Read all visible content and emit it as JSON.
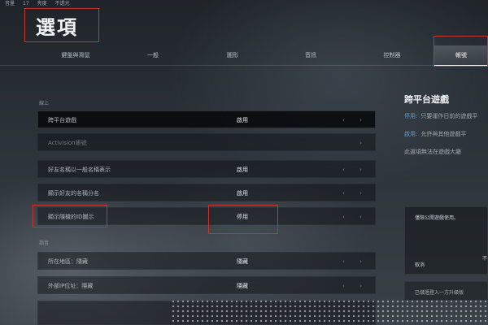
{
  "topbar": {
    "items": [
      "音量",
      "17",
      "亮度",
      "不透光"
    ]
  },
  "page": {
    "title": "選項"
  },
  "tabs": [
    {
      "label": "鍵盤與滑鼠",
      "active": false
    },
    {
      "label": "一般",
      "active": false
    },
    {
      "label": "圖形",
      "active": false
    },
    {
      "label": "音訊",
      "active": false
    },
    {
      "label": "控制器",
      "active": false
    },
    {
      "label": "帳號",
      "active": true
    }
  ],
  "sections": {
    "online": "線上",
    "voice": "語音"
  },
  "rows": [
    {
      "label": "跨平台遊戲",
      "value": "啟用",
      "selected": true
    },
    {
      "label": "Activision帳號",
      "value": "",
      "dim": true
    },
    {
      "label": "好友名稱以一般名稱表示",
      "value": "啟用"
    },
    {
      "label": "顯示好友的名稱分名",
      "value": "啟用"
    },
    {
      "label": "顯示隨機的ID圖示",
      "value": "停用"
    },
    {
      "label": "所在地區：隱藏",
      "value": "隱藏"
    },
    {
      "label": "外部IP位址：隱藏",
      "value": "隱藏"
    },
    {
      "label": "",
      "value": ""
    }
  ],
  "side_panel": {
    "title": "跨平台遊戲",
    "lines": [
      {
        "keyword": "停用:",
        "text": "只要運作日前的遊戲平"
      },
      {
        "keyword": "啟用:",
        "text": "允許與其他遊戲平"
      },
      {
        "keyword": "",
        "text": "此選項無法在遊戲大廳"
      }
    ],
    "info_box": {
      "text1": "僅限公開遊戲使用。",
      "text2": "取消",
      "text3": "不"
    },
    "info_box2": "已儲過登入一方升級版"
  },
  "arrows": "‹ ›",
  "colors": {
    "highlight": "#c8342c",
    "accent": "#4aa3e6"
  }
}
